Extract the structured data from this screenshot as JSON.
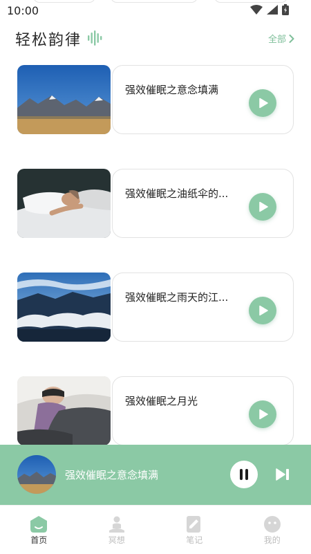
{
  "status_bar": {
    "time": "10:00"
  },
  "section": {
    "title": "轻松韵律",
    "see_all": "全部"
  },
  "tracks": [
    {
      "title": "强效催眠之意念填满"
    },
    {
      "title": "强效催眠之油纸伞的..."
    },
    {
      "title": "强效催眠之雨天的江..."
    },
    {
      "title": "强效催眠之月光"
    }
  ],
  "player": {
    "title": "强效催眠之意念填满",
    "state": "playing"
  },
  "nav": {
    "items": [
      {
        "label": "首页",
        "icon": "home-icon",
        "active": true
      },
      {
        "label": "冥想",
        "icon": "meditation-icon",
        "active": false
      },
      {
        "label": "笔记",
        "icon": "note-icon",
        "active": false
      },
      {
        "label": "我的",
        "icon": "profile-icon",
        "active": false
      }
    ]
  },
  "colors": {
    "accent": "#8bc9a5",
    "accent_text": "#7fbf9a"
  }
}
